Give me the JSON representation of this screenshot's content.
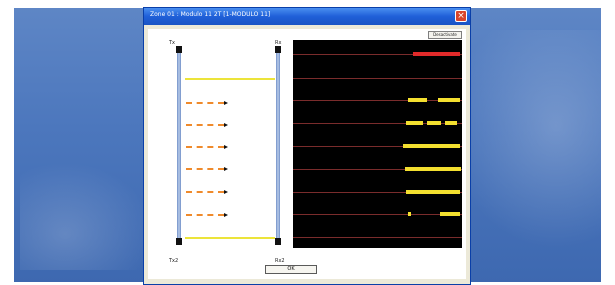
{
  "window": {
    "title": "Zone 01 : Modulo 11 2T [1-MODULO 11]",
    "close_glyph": "×"
  },
  "toolbar": {
    "disconnect_label": "Desactivate"
  },
  "left_panel": {
    "top_left_label": "Tx",
    "top_right_label": "Rx",
    "bottom_left_label": "Tx2",
    "bottom_right_label": "Rx2",
    "colors": {
      "beam_active": "#ece43a",
      "beam_inactive": "#ece43a",
      "arrow": "#ef8a2c"
    },
    "beams": [
      {
        "state": "line"
      },
      {
        "state": "arrow"
      },
      {
        "state": "arrow"
      },
      {
        "state": "arrow"
      },
      {
        "state": "arrow"
      },
      {
        "state": "arrow"
      },
      {
        "state": "arrow"
      },
      {
        "state": "line"
      }
    ]
  },
  "timeline": {
    "colors": {
      "background": "#000000",
      "line": "#7a2c2c",
      "alarm": "#e12a2a",
      "active": "#f3df2f"
    },
    "rows": [
      {
        "segments": [
          {
            "from": 0.71,
            "to": 0.99,
            "color": "alarm"
          }
        ]
      },
      {
        "segments": []
      },
      {
        "segments": [
          {
            "from": 0.68,
            "to": 0.79,
            "color": "active"
          },
          {
            "from": 0.86,
            "to": 0.99,
            "color": "active"
          }
        ]
      },
      {
        "segments": [
          {
            "from": 0.67,
            "to": 0.77,
            "color": "active"
          },
          {
            "from": 0.79,
            "to": 0.87,
            "color": "active"
          },
          {
            "from": 0.9,
            "to": 0.97,
            "color": "active"
          }
        ]
      },
      {
        "segments": [
          {
            "from": 0.65,
            "to": 0.99,
            "color": "active"
          }
        ]
      },
      {
        "segments": [
          {
            "from": 0.66,
            "to": 0.99,
            "color": "active"
          }
        ]
      },
      {
        "segments": [
          {
            "from": 0.67,
            "to": 0.99,
            "color": "active"
          }
        ]
      },
      {
        "segments": [
          {
            "from": 0.68,
            "to": 0.7,
            "color": "active"
          },
          {
            "from": 0.87,
            "to": 0.99,
            "color": "active"
          }
        ]
      },
      {
        "segments": []
      }
    ]
  },
  "footer": {
    "ok_label": "OK"
  }
}
